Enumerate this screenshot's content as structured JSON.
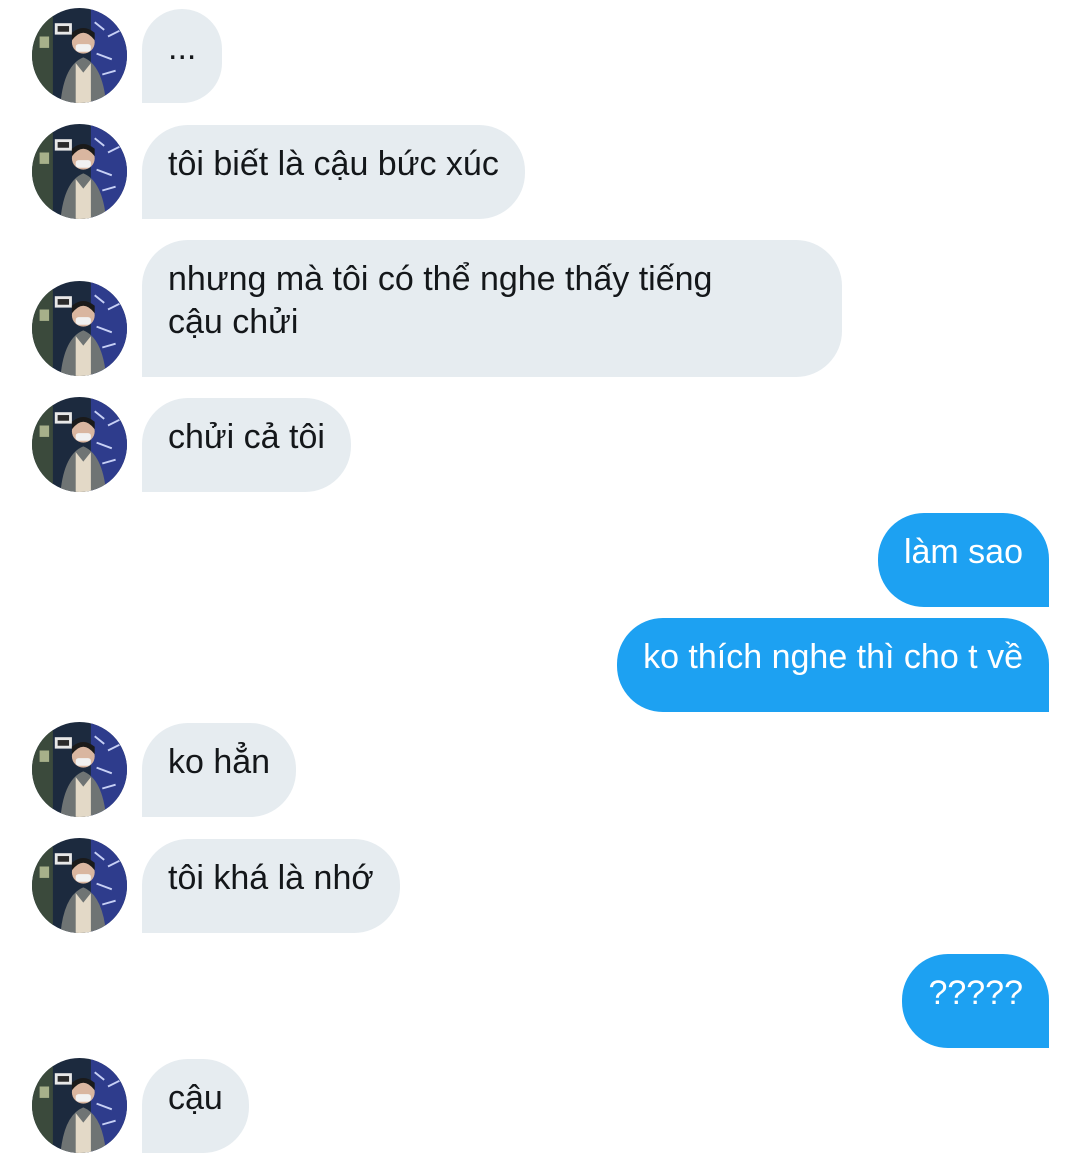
{
  "conversation": {
    "messages": [
      {
        "sender": "them",
        "text": "..."
      },
      {
        "sender": "them",
        "text": "tôi biết là cậu bức xúc"
      },
      {
        "sender": "them",
        "text": "nhưng mà tôi có thể nghe thấy tiếng\ncậu chửi"
      },
      {
        "sender": "them",
        "text": "chửi cả tôi"
      },
      {
        "sender": "me",
        "text": "làm sao"
      },
      {
        "sender": "me",
        "text": "ko thích nghe thì cho t về"
      },
      {
        "sender": "them",
        "text": "ko hẳn"
      },
      {
        "sender": "them",
        "text": "tôi khá là nhớ"
      },
      {
        "sender": "me",
        "text": "?????"
      },
      {
        "sender": "them",
        "text": "cậu"
      }
    ]
  },
  "colors": {
    "incoming_bubble": "#e6ecf0",
    "outgoing_bubble": "#1da1f2",
    "incoming_text": "#14171a",
    "outgoing_text": "#ffffff"
  },
  "icons": {
    "avatar": "avatar-photo-icon"
  }
}
